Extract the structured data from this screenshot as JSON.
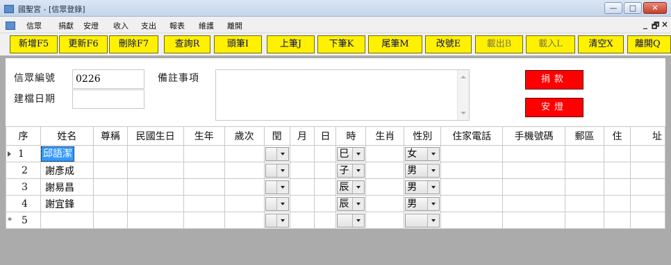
{
  "window": {
    "title": "國聖宮 - [信眾登錄]",
    "min_label": "—",
    "max_label": "□",
    "close_label": "✕"
  },
  "menu": {
    "items": [
      "信眾",
      "捐獻",
      "安燈",
      "收入",
      "支出",
      "報表",
      "維護",
      "離開"
    ],
    "mdi_min": "_",
    "mdi_restore": "🗗",
    "mdi_close": "×"
  },
  "toolbar": {
    "buttons": [
      {
        "label": "新增F5",
        "enabled": true
      },
      {
        "label": "更新F6",
        "enabled": true
      },
      {
        "label": "刪除F7",
        "enabled": true
      },
      {
        "label": "查詢R",
        "enabled": true
      },
      {
        "label": "頭筆I",
        "enabled": true
      },
      {
        "label": "上筆J",
        "enabled": true
      },
      {
        "label": "下筆K",
        "enabled": true
      },
      {
        "label": "尾筆M",
        "enabled": true
      },
      {
        "label": "改號E",
        "enabled": true
      },
      {
        "label": "載出B",
        "enabled": false
      },
      {
        "label": "載入L",
        "enabled": false
      },
      {
        "label": "清空X",
        "enabled": true
      },
      {
        "label": "離開Q",
        "enabled": true
      }
    ],
    "accent_color": "#fff100"
  },
  "form": {
    "member_no_label": "信眾編號",
    "member_no_value": "0226",
    "created_date_label": "建檔日期",
    "created_date_value": "",
    "remarks_label": "備註事項",
    "remarks_value": "",
    "donate_button": "捐款",
    "lamp_button": "安燈",
    "action_color": "#ff0000"
  },
  "grid": {
    "columns": [
      "序",
      "姓名",
      "尊稱",
      "民國生日",
      "生年",
      "歲次",
      "閏",
      "月",
      "日",
      "時",
      "生肖",
      "性別",
      "住家電話",
      "手機號碼",
      "郵區",
      "住",
      "址"
    ],
    "rows": [
      {
        "no": "1",
        "name": "邱語潔",
        "hour": "巳",
        "gender": "女",
        "current": true
      },
      {
        "no": "2",
        "name": "謝彥成",
        "hour": "子",
        "gender": "男"
      },
      {
        "no": "3",
        "name": "謝易昌",
        "hour": "辰",
        "gender": "男"
      },
      {
        "no": "4",
        "name": "謝宜鋒",
        "hour": "辰",
        "gender": "男"
      },
      {
        "no": "5",
        "name": "",
        "hour": "",
        "gender": "",
        "new_row": true
      }
    ],
    "new_row_marker": "*"
  }
}
